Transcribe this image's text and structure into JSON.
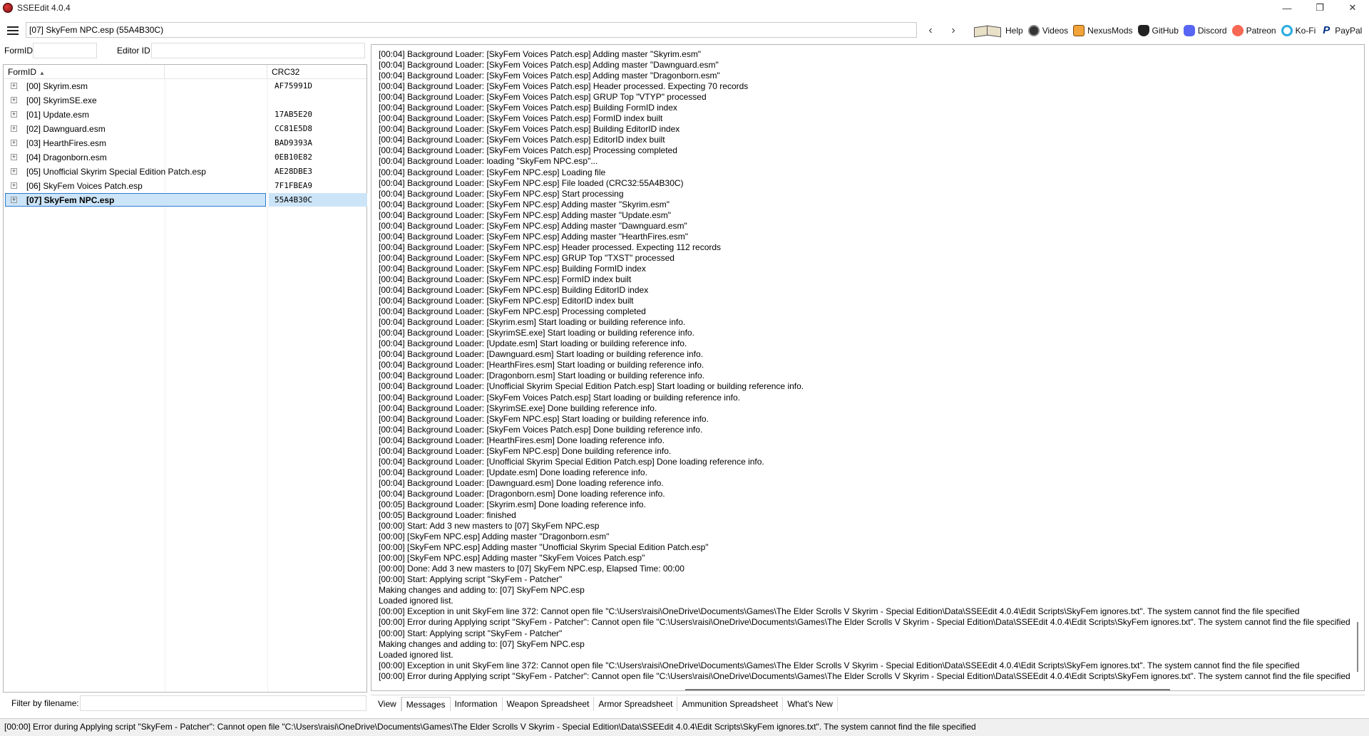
{
  "window": {
    "title": "SSEEdit 4.0.4"
  },
  "toolbar": {
    "path": "[07] SkyFem NPC.esp (55A4B30C)",
    "back_icon": "arrow-left-icon",
    "forward_icon": "arrow-right-icon",
    "links": [
      {
        "label": "Help",
        "icon": "book-icon"
      },
      {
        "label": "Videos",
        "icon": "videos-icon"
      },
      {
        "label": "NexusMods",
        "icon": "nexusmods-icon"
      },
      {
        "label": "GitHub",
        "icon": "github-icon"
      },
      {
        "label": "Discord",
        "icon": "discord-icon"
      },
      {
        "label": "Patreon",
        "icon": "patreon-icon"
      },
      {
        "label": "Ko-Fi",
        "icon": "kofi-icon"
      },
      {
        "label": "PayPal",
        "icon": "paypal-icon"
      }
    ]
  },
  "filters": {
    "formid_label": "FormID",
    "formid_value": "",
    "editorid_label": "Editor ID",
    "editorid_value": "",
    "filename_label": "Filter by filename:",
    "filename_value": ""
  },
  "tree": {
    "columns": [
      "FormID",
      "CRC32"
    ],
    "rows": [
      {
        "name": "[00] Skyrim.esm",
        "crc": "AF75991D",
        "selected": false
      },
      {
        "name": "[00] SkyrimSE.exe",
        "crc": "",
        "selected": false
      },
      {
        "name": "[01] Update.esm",
        "crc": "17AB5E20",
        "selected": false
      },
      {
        "name": "[02] Dawnguard.esm",
        "crc": "CC81E5D8",
        "selected": false
      },
      {
        "name": "[03] HearthFires.esm",
        "crc": "BAD9393A",
        "selected": false
      },
      {
        "name": "[04] Dragonborn.esm",
        "crc": "0EB10E82",
        "selected": false
      },
      {
        "name": "[05] Unofficial Skyrim Special Edition Patch.esp",
        "crc": "AE28DBE3",
        "selected": false
      },
      {
        "name": "[06] SkyFem Voices Patch.esp",
        "crc": "7F1FBEA9",
        "selected": false
      },
      {
        "name": "[07] SkyFem NPC.esp",
        "crc": "55A4B30C",
        "selected": true
      }
    ]
  },
  "log": [
    "[00:04] Background Loader: [SkyFem Voices Patch.esp] Adding master \"Skyrim.esm\"",
    "[00:04] Background Loader: [SkyFem Voices Patch.esp] Adding master \"Dawnguard.esm\"",
    "[00:04] Background Loader: [SkyFem Voices Patch.esp] Adding master \"Dragonborn.esm\"",
    "[00:04] Background Loader: [SkyFem Voices Patch.esp] Header processed. Expecting 70 records",
    "[00:04] Background Loader: [SkyFem Voices Patch.esp] GRUP Top \"VTYP\" processed",
    "[00:04] Background Loader: [SkyFem Voices Patch.esp] Building FormID index",
    "[00:04] Background Loader: [SkyFem Voices Patch.esp] FormID index built",
    "[00:04] Background Loader: [SkyFem Voices Patch.esp] Building EditorID index",
    "[00:04] Background Loader: [SkyFem Voices Patch.esp] EditorID index built",
    "[00:04] Background Loader: [SkyFem Voices Patch.esp] Processing completed",
    "[00:04] Background Loader: loading \"SkyFem NPC.esp\"...",
    "[00:04] Background Loader: [SkyFem NPC.esp] Loading file",
    "[00:04] Background Loader: [SkyFem NPC.esp] File loaded (CRC32:55A4B30C)",
    "[00:04] Background Loader: [SkyFem NPC.esp] Start processing",
    "[00:04] Background Loader: [SkyFem NPC.esp] Adding master \"Skyrim.esm\"",
    "[00:04] Background Loader: [SkyFem NPC.esp] Adding master \"Update.esm\"",
    "[00:04] Background Loader: [SkyFem NPC.esp] Adding master \"Dawnguard.esm\"",
    "[00:04] Background Loader: [SkyFem NPC.esp] Adding master \"HearthFires.esm\"",
    "[00:04] Background Loader: [SkyFem NPC.esp] Header processed. Expecting 112 records",
    "[00:04] Background Loader: [SkyFem NPC.esp] GRUP Top \"TXST\" processed",
    "[00:04] Background Loader: [SkyFem NPC.esp] Building FormID index",
    "[00:04] Background Loader: [SkyFem NPC.esp] FormID index built",
    "[00:04] Background Loader: [SkyFem NPC.esp] Building EditorID index",
    "[00:04] Background Loader: [SkyFem NPC.esp] EditorID index built",
    "[00:04] Background Loader: [SkyFem NPC.esp] Processing completed",
    "[00:04] Background Loader: [Skyrim.esm] Start loading or building reference info.",
    "[00:04] Background Loader: [SkyrimSE.exe] Start loading or building reference info.",
    "[00:04] Background Loader: [Update.esm] Start loading or building reference info.",
    "[00:04] Background Loader: [Dawnguard.esm] Start loading or building reference info.",
    "[00:04] Background Loader: [HearthFires.esm] Start loading or building reference info.",
    "[00:04] Background Loader: [Dragonborn.esm] Start loading or building reference info.",
    "[00:04] Background Loader: [Unofficial Skyrim Special Edition Patch.esp] Start loading or building reference info.",
    "[00:04] Background Loader: [SkyFem Voices Patch.esp] Start loading or building reference info.",
    "[00:04] Background Loader: [SkyrimSE.exe] Done building reference info.",
    "[00:04] Background Loader: [SkyFem NPC.esp] Start loading or building reference info.",
    "[00:04] Background Loader: [SkyFem Voices Patch.esp] Done building reference info.",
    "[00:04] Background Loader: [HearthFires.esm] Done loading reference info.",
    "[00:04] Background Loader: [SkyFem NPC.esp] Done building reference info.",
    "[00:04] Background Loader: [Unofficial Skyrim Special Edition Patch.esp] Done loading reference info.",
    "[00:04] Background Loader: [Update.esm] Done loading reference info.",
    "[00:04] Background Loader: [Dawnguard.esm] Done loading reference info.",
    "[00:04] Background Loader: [Dragonborn.esm] Done loading reference info.",
    "[00:05] Background Loader: [Skyrim.esm] Done loading reference info.",
    "[00:05] Background Loader: finished",
    "[00:00] Start: Add 3 new masters to [07] SkyFem NPC.esp",
    "[00:00] [SkyFem NPC.esp] Adding master \"Dragonborn.esm\"",
    "[00:00] [SkyFem NPC.esp] Adding master \"Unofficial Skyrim Special Edition Patch.esp\"",
    "[00:00] [SkyFem NPC.esp] Adding master \"SkyFem Voices Patch.esp\"",
    "[00:00] Done: Add 3 new masters to [07] SkyFem NPC.esp, Elapsed Time: 00:00",
    "[00:00] Start: Applying script \"SkyFem - Patcher\"",
    "Making changes and adding to: [07] SkyFem NPC.esp",
    "Loaded ignored list.",
    "[00:00] Exception in unit SkyFem line 372: Cannot open file \"C:\\Users\\raisi\\OneDrive\\Documents\\Games\\The Elder Scrolls V Skyrim - Special Edition\\Data\\SSEEdit 4.0.4\\Edit Scripts\\SkyFem ignores.txt\". The system cannot find the file specified",
    "[00:00] Error during Applying script \"SkyFem - Patcher\": Cannot open file \"C:\\Users\\raisi\\OneDrive\\Documents\\Games\\The Elder Scrolls V Skyrim - Special Edition\\Data\\SSEEdit 4.0.4\\Edit Scripts\\SkyFem ignores.txt\". The system cannot find the file specified",
    "[00:00] Start: Applying script \"SkyFem - Patcher\"",
    "Making changes and adding to: [07] SkyFem NPC.esp",
    "Loaded ignored list.",
    "[00:00] Exception in unit SkyFem line 372: Cannot open file \"C:\\Users\\raisi\\OneDrive\\Documents\\Games\\The Elder Scrolls V Skyrim - Special Edition\\Data\\SSEEdit 4.0.4\\Edit Scripts\\SkyFem ignores.txt\". The system cannot find the file specified",
    "[00:00] Error during Applying script \"SkyFem - Patcher\": Cannot open file \"C:\\Users\\raisi\\OneDrive\\Documents\\Games\\The Elder Scrolls V Skyrim - Special Edition\\Data\\SSEEdit 4.0.4\\Edit Scripts\\SkyFem ignores.txt\". The system cannot find the file specified"
  ],
  "tabs": [
    {
      "label": "View",
      "active": false
    },
    {
      "label": "Messages",
      "active": true
    },
    {
      "label": "Information",
      "active": false
    },
    {
      "label": "Weapon Spreadsheet",
      "active": false
    },
    {
      "label": "Armor Spreadsheet",
      "active": false
    },
    {
      "label": "Ammunition Spreadsheet",
      "active": false
    },
    {
      "label": "What's New",
      "active": false
    }
  ],
  "status": "[00:00] Error during Applying script \"SkyFem - Patcher\": Cannot open file \"C:\\Users\\raisi\\OneDrive\\Documents\\Games\\The Elder Scrolls V Skyrim - Special Edition\\Data\\SSEEdit 4.0.4\\Edit Scripts\\SkyFem ignores.txt\". The system cannot find the file specified"
}
